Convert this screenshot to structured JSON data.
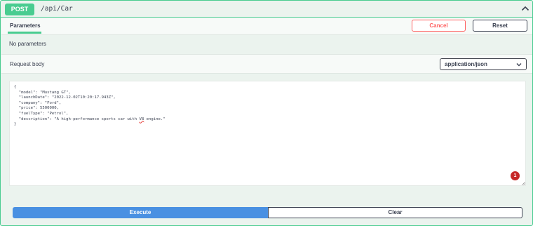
{
  "operation": {
    "method": "POST",
    "path": "/api/Car",
    "collapse_icon": "chevron-up-icon"
  },
  "parameters": {
    "tab_label": "Parameters",
    "cancel_label": "Cancel",
    "reset_label": "Reset",
    "empty_text": "No parameters"
  },
  "request_body": {
    "label": "Request body",
    "content_type": "application/json",
    "select_icon": "chevron-down-icon",
    "lines": [
      "{",
      "  \"model\": \"Mustang GT\",",
      "  \"launchDate\": \"2022-12-02T10:20:17.943Z\",",
      "  \"company\": \"Ford\",",
      "  \"price\": 5500000,",
      "  \"fuelType\": \"Petrol\","
    ],
    "description_prefix": "  \"description\": \"A high-performance sports car with ",
    "description_flagged": "V8",
    "description_suffix": " engine.\"",
    "closing": "}",
    "issue_count": "1"
  },
  "actions": {
    "execute_label": "Execute",
    "clear_label": "Clear"
  },
  "colors": {
    "post_green": "#49cc90",
    "execute_blue": "#4990e2",
    "cancel_red": "#ff6060",
    "issue_red": "#c62828"
  }
}
